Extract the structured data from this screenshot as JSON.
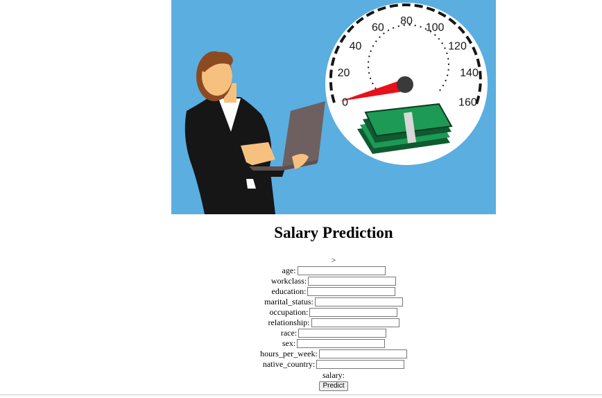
{
  "page": {
    "title": "Salary Prediction",
    "marker": ">"
  },
  "hero": {
    "gauge_labels": [
      "0",
      "20",
      "40",
      "60",
      "80",
      "100",
      "120",
      "140",
      "160"
    ],
    "colors": {
      "background": "#5aaee0",
      "needle": "#e8101a",
      "cash": "#1d9a55",
      "suit": "#161616",
      "laptop": "#6e6060"
    }
  },
  "form": {
    "fields": [
      {
        "label": "age:",
        "value": ""
      },
      {
        "label": "workclass:",
        "value": ""
      },
      {
        "label": "education:",
        "value": ""
      },
      {
        "label": "marital_status:",
        "value": ""
      },
      {
        "label": "occupation:",
        "value": ""
      },
      {
        "label": "relationship:",
        "value": ""
      },
      {
        "label": "race:",
        "value": ""
      },
      {
        "label": "sex:",
        "value": ""
      },
      {
        "label": "hours_per_week:",
        "value": ""
      },
      {
        "label": "native_country:",
        "value": ""
      }
    ],
    "salary_label": "salary:",
    "predict_label": "Predict"
  }
}
